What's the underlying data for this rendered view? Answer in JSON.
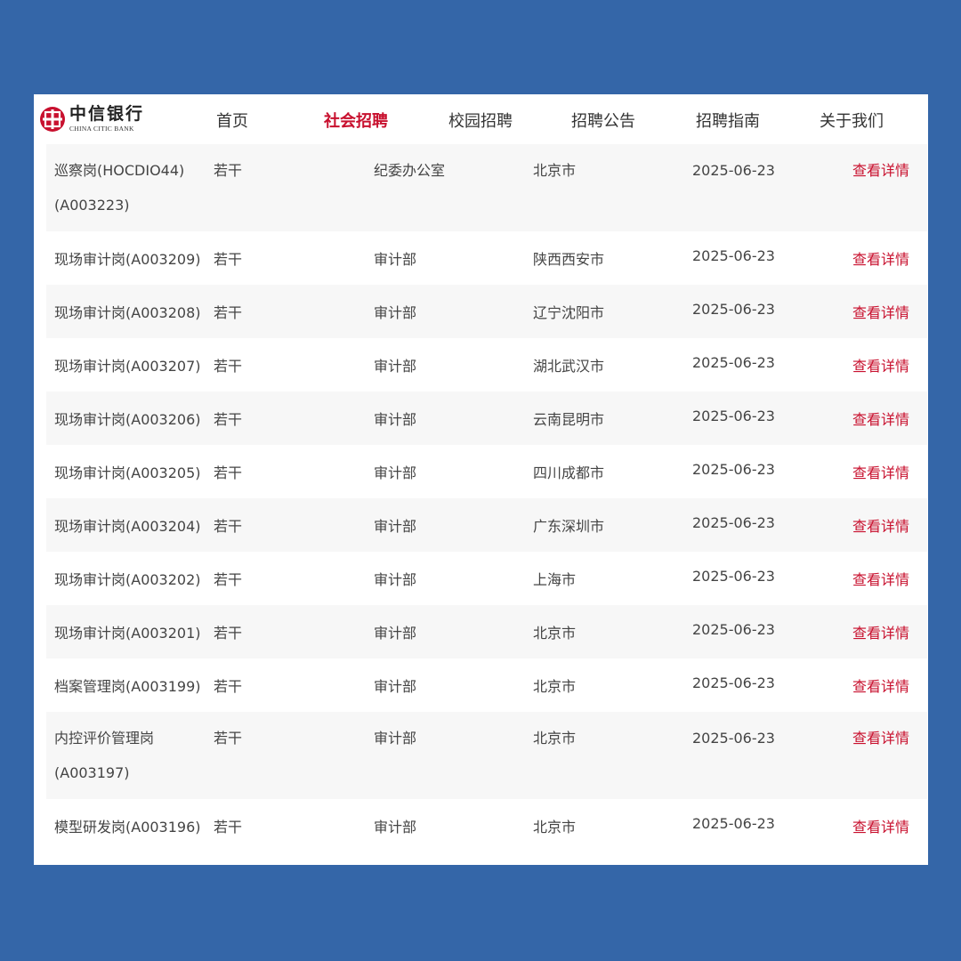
{
  "brand": {
    "name_cn": "中信银行",
    "name_en": "CHINA CITIC BANK",
    "color": "#c8102e"
  },
  "nav": [
    {
      "label": "首页",
      "active": false
    },
    {
      "label": "社会招聘",
      "active": true
    },
    {
      "label": "校园招聘",
      "active": false
    },
    {
      "label": "招聘公告",
      "active": false
    },
    {
      "label": "招聘指南",
      "active": false
    },
    {
      "label": "关于我们",
      "active": false
    }
  ],
  "jobs": [
    {
      "title": "巡察岗(HOCDIO44)(A003223)",
      "count": "若干",
      "dept": "纪委办公室",
      "location": "北京市",
      "date": "2025-06-23",
      "link": "查看详情"
    },
    {
      "title": "现场审计岗(A003209)",
      "count": "若干",
      "dept": "审计部",
      "location": "陕西西安市",
      "date": "2025-06-23",
      "link": "查看详情"
    },
    {
      "title": "现场审计岗(A003208)",
      "count": "若干",
      "dept": "审计部",
      "location": "辽宁沈阳市",
      "date": "2025-06-23",
      "link": "查看详情"
    },
    {
      "title": "现场审计岗(A003207)",
      "count": "若干",
      "dept": "审计部",
      "location": "湖北武汉市",
      "date": "2025-06-23",
      "link": "查看详情"
    },
    {
      "title": "现场审计岗(A003206)",
      "count": "若干",
      "dept": "审计部",
      "location": "云南昆明市",
      "date": "2025-06-23",
      "link": "查看详情"
    },
    {
      "title": "现场审计岗(A003205)",
      "count": "若干",
      "dept": "审计部",
      "location": "四川成都市",
      "date": "2025-06-23",
      "link": "查看详情"
    },
    {
      "title": "现场审计岗(A003204)",
      "count": "若干",
      "dept": "审计部",
      "location": "广东深圳市",
      "date": "2025-06-23",
      "link": "查看详情"
    },
    {
      "title": "现场审计岗(A003202)",
      "count": "若干",
      "dept": "审计部",
      "location": "上海市",
      "date": "2025-06-23",
      "link": "查看详情"
    },
    {
      "title": "现场审计岗(A003201)",
      "count": "若干",
      "dept": "审计部",
      "location": "北京市",
      "date": "2025-06-23",
      "link": "查看详情"
    },
    {
      "title": "档案管理岗(A003199)",
      "count": "若干",
      "dept": "审计部",
      "location": "北京市",
      "date": "2025-06-23",
      "link": "查看详情"
    },
    {
      "title": "内控评价管理岗(A003197)",
      "count": "若干",
      "dept": "审计部",
      "location": "北京市",
      "date": "2025-06-23",
      "link": "查看详情"
    },
    {
      "title": "模型研发岗(A003196)",
      "count": "若干",
      "dept": "审计部",
      "location": "北京市",
      "date": "2025-06-23",
      "link": "查看详情"
    }
  ]
}
